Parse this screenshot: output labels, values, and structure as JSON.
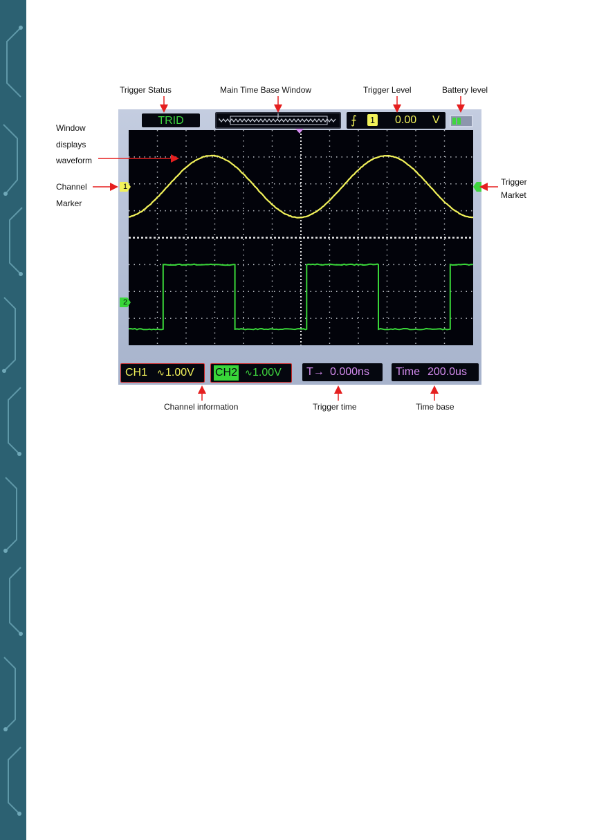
{
  "annotations": {
    "trigger_status": "Trigger Status",
    "main_time_base_window": "Main Time  Base Window",
    "trigger_level": "Trigger Level",
    "battery_level": "Battery level",
    "window_line1": "Window",
    "window_line2": "displays",
    "window_line3": "waveform",
    "channel_marker_line1": "Channel",
    "channel_marker_line2": "Marker",
    "trigger_market_line1": "Trigger",
    "trigger_market_line2": "Market",
    "channel_information": "Channel  information",
    "trigger_time": "Trigger time",
    "time_base": "Time base"
  },
  "scope": {
    "trigger_status": "TRID",
    "trigger_channel": "1",
    "trigger_level_value": "0.00",
    "trigger_level_unit": "V",
    "ch1_label": "CH1",
    "ch1_volts": "1.00V",
    "ch2_label": "CH2",
    "ch2_volts": "1.00V",
    "trigger_time_label": "T→",
    "trigger_time_value": "0.000ns",
    "time_label": "Time",
    "time_value": "200.0us",
    "ch1_marker": "1",
    "ch2_marker": "2",
    "coupling_symbol": "∿",
    "trigger_edge_symbol": "⨍"
  },
  "colors": {
    "ch1": "#f2f25a",
    "ch2": "#39d639",
    "trigger_label": "#3fd63f",
    "time_info": "#d58cf0",
    "screen_bg": "#02030a",
    "side_band": "#2c6172"
  },
  "icons": {
    "battery": "battery-icon",
    "trigger_edge": "rising-edge-icon",
    "trigger_position": "trigger-position-icon"
  }
}
